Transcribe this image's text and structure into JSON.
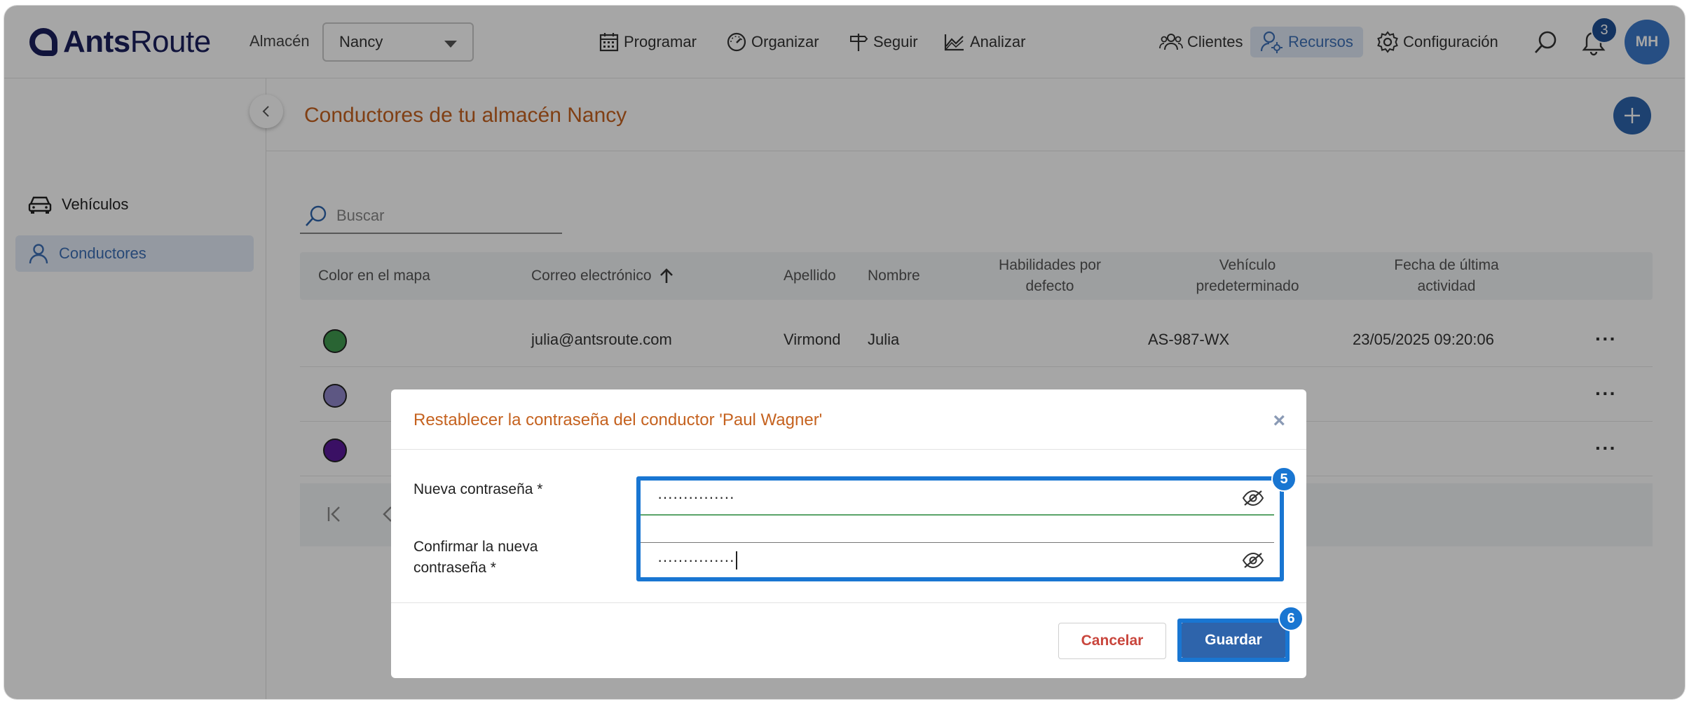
{
  "app": {
    "logo_bold": "Ants",
    "logo_regular": "Route"
  },
  "topbar": {
    "warehouse_label": "Almacén",
    "warehouse_value": "Nancy",
    "nav": {
      "schedule": "Programar",
      "organize": "Organizar",
      "track": "Seguir",
      "analyze": "Analizar",
      "clients": "Clientes",
      "resources": "Recursos",
      "settings": "Configuración"
    },
    "notification_count": "3",
    "user_initials": "MH"
  },
  "sidebar": {
    "items": [
      {
        "label": "Vehículos",
        "icon": "car-icon"
      },
      {
        "label": "Conductores",
        "icon": "person-icon",
        "active": true
      }
    ]
  },
  "main": {
    "title": "Conductores de tu almacén Nancy",
    "search_placeholder": "Buscar",
    "columns": {
      "color": "Color en el mapa",
      "email": "Correo electrónico",
      "last_name": "Apellido",
      "first_name": "Nombre",
      "skills_1": "Habilidades por",
      "skills_2": "defecto",
      "vehicle_1": "Vehículo",
      "vehicle_2": "predeterminado",
      "activity_1": "Fecha de última",
      "activity_2": "actividad"
    },
    "rows": [
      {
        "color": "#3f9a4f",
        "email": "julia@antsroute.com",
        "last_name": "Virmond",
        "first_name": "Julia",
        "vehicle": "AS-987-WX",
        "last_activity": "23/05/2025 09:20:06"
      },
      {
        "color": "#8f86c9",
        "email": "",
        "last_name": "",
        "first_name": "",
        "vehicle": "",
        "last_activity": ""
      },
      {
        "color": "#5a1a9a",
        "email": "",
        "last_name": "",
        "first_name": "",
        "vehicle": "",
        "last_activity": ""
      }
    ],
    "more_label": "···"
  },
  "modal": {
    "title": "Restablecer la contraseña del conductor 'Paul Wagner'",
    "close": "×",
    "new_password_label": "Nueva contraseña *",
    "new_password_value": "···············",
    "confirm_label_1": "Confirmar la nueva",
    "confirm_label_2": "contraseña *",
    "confirm_value": "···············",
    "cancel": "Cancelar",
    "save": "Guardar",
    "step_fields": "5",
    "step_save": "6"
  },
  "colors": {
    "accent": "#c5621f",
    "primary": "#2e64ab",
    "highlight": "#1976d2"
  }
}
